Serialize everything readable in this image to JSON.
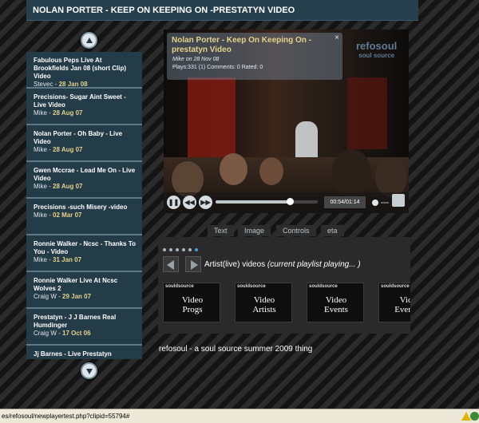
{
  "page": {
    "title": "NOLAN PORTER - KEEP ON KEEPING ON -PRESTATYN VIDEO"
  },
  "playlist": {
    "items": [
      {
        "title": "Fabulous Peps Live At Brookfields Jan 08 (short Clip) Video",
        "author": "Stevec",
        "date": "28 Jan 08"
      },
      {
        "title": "Precisions- Sugar Aint Sweet - Live Video",
        "author": "Mike",
        "date": "28 Aug 07"
      },
      {
        "title": "Nolan Porter - Oh Baby - Live Video",
        "author": "Mike",
        "date": "28 Aug 07"
      },
      {
        "title": "Gwen Mccrae - Lead Me On - Live Video",
        "author": "Mike",
        "date": "28 Aug 07"
      },
      {
        "title": "Precisions -such Misery -video",
        "author": "Mike",
        "date": "02 Mar 07"
      },
      {
        "title": "Ronnie Walker - Ncsc - Thanks To You - Video",
        "author": "Mike",
        "date": "31 Jan 07"
      },
      {
        "title": "Ronnie Walker Live At Ncsc Wolves 2",
        "author": "Craig W",
        "date": "29 Jan 07"
      },
      {
        "title": "Prestatyn - J J Barnes Real Humdinger",
        "author": "Craig W",
        "date": "17 Oct 06"
      },
      {
        "title": "Jj Barnes - Live Prestatyn",
        "author": "",
        "date": ""
      }
    ]
  },
  "video": {
    "title": "Nolan Porter - Keep On Keeping On - prestatyn Video",
    "byline": "Mike on 28 Nov 08",
    "stats": "Plays:331 (1)   Comments: 0   Rated: 0",
    "close_glyph": "×",
    "brand_line1": "refosoul",
    "brand_line2": "soul source",
    "time": "00:54/01:14",
    "progress": 0.73,
    "play_state": "paused"
  },
  "tabs": [
    "Text",
    "Image",
    "Controls",
    "eta"
  ],
  "panel": {
    "heading_prefix": "Artist(live) videos",
    "heading_italic": "(current playlist  playing... )",
    "heading_suffix": "",
    "active_dot_index": 5,
    "cards": [
      {
        "logo": "souldsource",
        "label": "Video\nProgs"
      },
      {
        "logo": "souldsource",
        "label": "Video\nArtists"
      },
      {
        "logo": "souldsource",
        "label": "Video\nEvents"
      },
      {
        "logo": "souldsource",
        "label": "Vide\nEvents("
      }
    ]
  },
  "tagline": "refosoul - a soul source summer 2009 thing",
  "statusbar": {
    "url": "es/refosoul/newplayertest.php?clipid=55794#"
  },
  "colors": {
    "accent_date": "#e3d28b",
    "title_bar": "#263f4d",
    "playlist_bg": "#243b48",
    "active_dot": "#3ba0d8"
  }
}
